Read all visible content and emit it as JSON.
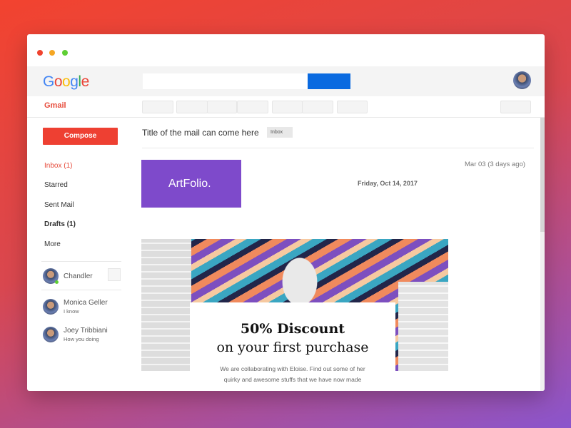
{
  "window_controls": {
    "colors": [
      "#f0432f",
      "#f5a623",
      "#5fcf34"
    ]
  },
  "header": {
    "logo": "Google",
    "search_value": "",
    "search_button_color": "#0a6ae0"
  },
  "app": {
    "name": "Gmail"
  },
  "sidebar": {
    "compose_label": "Compose",
    "nav": [
      {
        "label": "Inbox (1)",
        "active": true
      },
      {
        "label": "Starred"
      },
      {
        "label": "Sent Mail"
      },
      {
        "label": "Drafts (1)",
        "bold": true
      },
      {
        "label": "More"
      }
    ],
    "current_user": {
      "name": "Chandler",
      "status": "online"
    },
    "contacts": [
      {
        "name": "Monica Geller",
        "message": "I know"
      },
      {
        "name": "Joey Tribbiani",
        "message": "How you doing"
      }
    ]
  },
  "mail": {
    "title": "Title of the mail can come here",
    "label": "Inbox",
    "received": "Mar 03 (3 days ago)",
    "sender_logo": "ArtFolio.",
    "date": "Friday, Oct 14, 2017",
    "headline": "50% Discount",
    "subheadline": "on your first purchase",
    "body": "We are collaborating with Eloise. Find out some of her quirky and awesome stuffs that we have now made"
  }
}
